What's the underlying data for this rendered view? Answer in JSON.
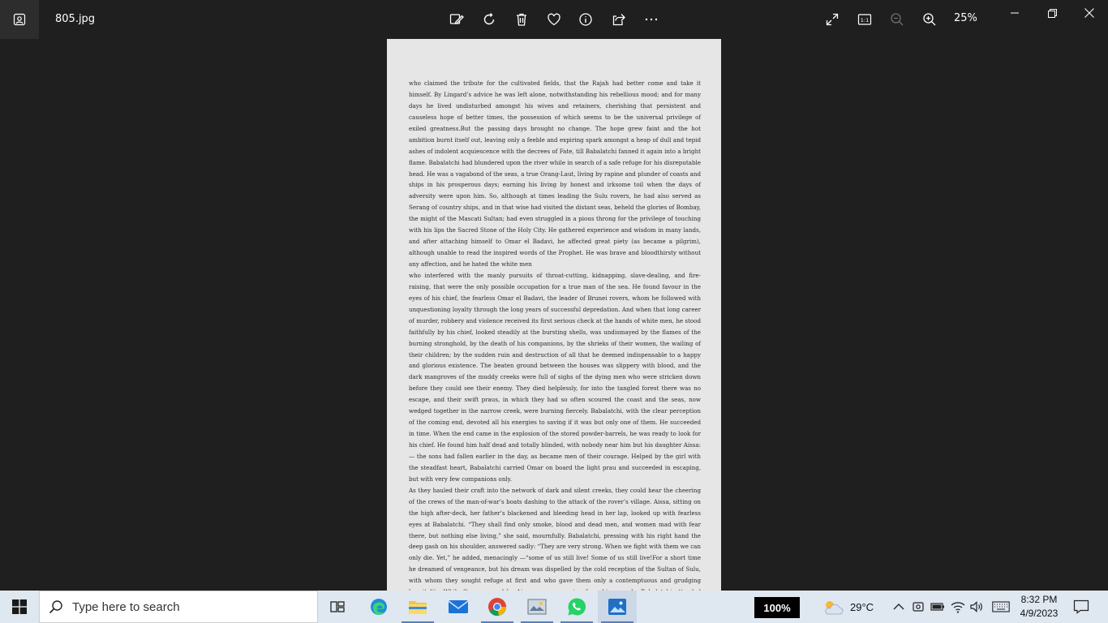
{
  "window": {
    "filename": "805.jpg",
    "zoom_level": "25%",
    "actual_size_label": "1:1"
  },
  "toolbar": {
    "icons": [
      "edit-image-icon",
      "rotate-icon",
      "delete-icon",
      "favorite-icon",
      "info-icon",
      "share-icon",
      "more-icon"
    ],
    "right_icons": [
      "fullscreen-icon",
      "actual-size-icon",
      "zoom-out-icon",
      "zoom-in-icon"
    ],
    "window_controls": [
      "minimize-icon",
      "restore-icon",
      "close-icon"
    ]
  },
  "document": {
    "paragraphs": [
      "who claimed the tribute for the cultivated fields, that the Rajah had better come and take it himself. By Lingard’s advice he was left alone, notwithstanding his rebellious mood; and for many days he lived undisturbed amongst his wives and retainers, cherishing that persistent and causeless hope of better times, the possession of which seems to be the universal privilege of exiled greatness.But the passing days brought no change. The hope grew faint and the hot ambition burnt itself out, leaving only a feeble and expiring spark amongst a heap of dull and tepid ashes of indolent acquiescence with the decrees of Fate, till Babalatchi fanned it again into a bright flame. Babalatchi had blundered upon the river while in search of a safe refuge for his disreputable head. He was a vagabond of the seas, a true Orang-Laut, living by rapine and plunder of coasts and ships in his prosperous days; earning his living by honest and irksome toil when the days of adversity were upon him. So, although at times leading the Sulu rovers, he had also served as Serang of country ships, and in that wise had visited the distant seas, beheld the glories of Bombay, the might of the Mascati Sultan; had even struggled in a pious throng for the privilege of touching with his lips the Sacred Stone of the Holy City. He gathered experience and wisdom in many lands, and after attaching himself to Omar el Badavi, he affected great piety (as became a pilgrim), although unable to read the inspired words of the Prophet. He was brave and bloodthirsty without any affection, and he hated the white men",
      "who interfered with the manly pursuits of throat-cutting, kidnapping, slave-dealing, and fire-raising, that were the only possible occupation for a true man of the sea. He found favour in the eyes of his chief, the fearless Omar el Badavi, the leader of Brunei rovers, whom he followed with unquestioning loyalty through the long years of successful depredation. And when that long career of murder, robbery and violence received its first serious check at the hands of white men, he stood faithfully by his chief, looked steadily at the bursting shells, was undismayed by the flames of the burning stronghold, by the death of his companions, by the shrieks of their women, the wailing of their children; by the sudden ruin and destruction of all that he deemed indispensable to a happy and glorious existence. The beaten ground between the houses was slippery with blood, and the dark mangroves of the muddy creeks were full of sighs of the dying men who were stricken down before they could see their enemy. They died helplessly, for into the tangled forest there was no escape, and their swift praus, in which they had so often scoured the coast and the seas, now wedged together in the narrow creek, were burning fiercely. Babalatchi, with the clear perception of the coming end, devoted all his energies to saving if it was but only one of them. He succeeded in time. When the end came in the explosion of the stored powder-barrels, he was ready to look for his chief. He found him half dead and totally blinded, with nobody near him but his daughter Aissa:— the sons had fallen earlier in the day, as became men of their courage. Helped by the girl with the steadfast heart, Babalatchi carried Omar on board the light prau and succeeded in escaping, but with very few companions only.",
      "As they hauled their craft into the network of dark and silent creeks, they could hear the cheering of the crews of the man-of-war’s boats dashing to the attack of the rover’s village. Aissa, sitting on the high after-deck, her father’s blackened and bleeding head in her lap, looked up with fearless eyes at Babalatchi. “They shall find only smoke, blood and dead men, and women mad with fear there, but nothing else living,” she said, mournfully. Babalatchi, pressing with his right hand the deep gash on his shoulder, answered sadly: “They are very strong. When we fight with them we can only die. Yet,” he added, menacingly —“some of us still live! Some of us still live!For a short time he dreamed of vengeance, but his dream was dispelled by the cold reception of the Sultan of Sulu, with whom they sought refuge at first and who gave them only a contemptuous and grudging hospitality. While Omar, nursed by Aissa, was recovering from his wounds, Babalatchi attended industriously before the exalted Presence that had extended to them the hand of Protection. For all that, when Babalatchi spoke into the Sultan’s ear certain proposals of a great and profitable raid, that was to sweep the islands from Ternate to Acheen, the Sultan was very angry. “I know you, you men from the west,” he exclaimed, angrily. “"
    ]
  },
  "taskbar": {
    "search_placeholder": "Type here to search",
    "apps": [
      "task-view-icon",
      "edge-icon",
      "file-explorer-icon",
      "mail-icon",
      "chrome-icon",
      "photos-gallery-icon",
      "whatsapp-icon",
      "photos-icon"
    ],
    "volume_percent": "100%",
    "temperature": "29°C",
    "time": "8:32 PM",
    "date": "4/9/2023"
  }
}
